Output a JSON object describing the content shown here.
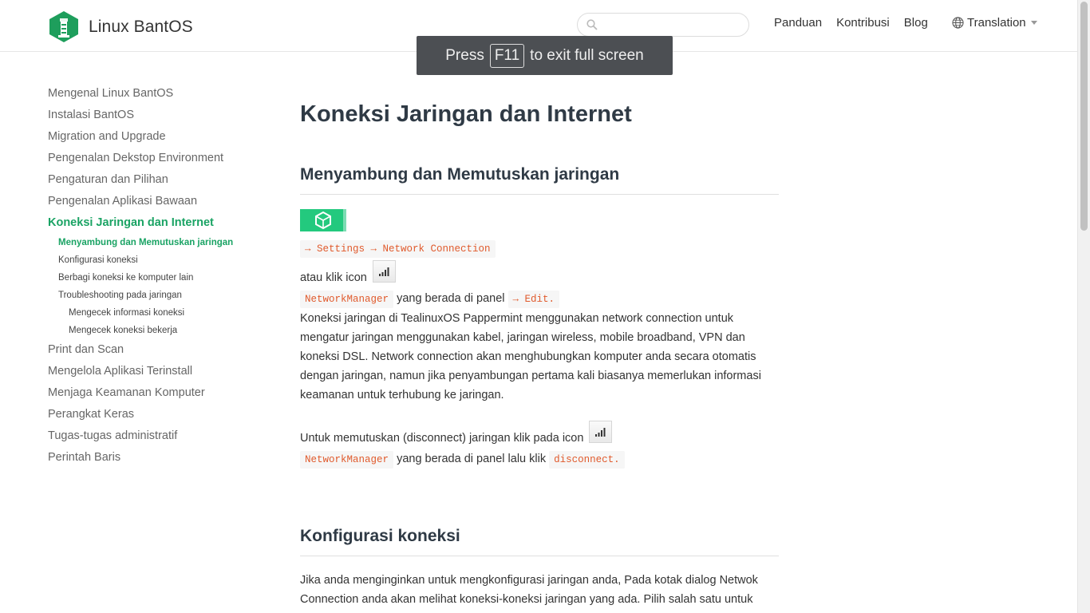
{
  "header": {
    "brand": "Linux BantOS",
    "search_placeholder": "",
    "nav": [
      "Panduan",
      "Kontribusi",
      "Blog"
    ],
    "translation": "Translation"
  },
  "fullscreen_toast": {
    "prefix": "Press",
    "key": "F11",
    "suffix": "to exit full screen"
  },
  "sidebar": {
    "items": [
      "Mengenal Linux BantOS",
      "Instalasi BantOS",
      "Migration and Upgrade",
      "Pengenalan Dekstop Environment",
      "Pengaturan dan Pilihan",
      "Pengenalan Aplikasi Bawaan",
      "Koneksi Jaringan dan Internet"
    ],
    "subitems": [
      "Menyambung dan Memutuskan jaringan",
      "Konfigurasi koneksi",
      "Berbagi koneksi ke komputer lain",
      "Troubleshooting pada jaringan"
    ],
    "subsubitems": [
      "Mengecek informasi koneksi",
      "Mengecek koneksi bekerja"
    ],
    "items_after": [
      "Print dan Scan",
      "Mengelola Aplikasi Terinstall",
      "Menjaga Keamanan Komputer",
      "Perangkat Keras",
      "Tugas-tugas administratif",
      "Perintah Baris"
    ]
  },
  "content": {
    "title": "Koneksi Jaringan dan Internet",
    "section1": {
      "heading": "Menyambung dan Memutuskan jaringan",
      "settings_path": "→ Settings → Network Connection",
      "click_icon_text": "atau klik icon",
      "network_manager": "NetworkManager",
      "panel_text": "yang berada di panel",
      "edit": "→ Edit.",
      "paragraph": "Koneksi jaringan di TealinuxOS Pappermint menggunakan network connection untuk mengatur jaringan menggunakan kabel, jaringan wireless, mobile broadband, VPN dan koneksi DSL. Network connection akan menghubungkan komputer anda secara otomatis dengan jaringan, namun jika penyambungan pertama kali biasanya memerlukan informasi keamanan untuk terhubung ke jaringan.",
      "disconnect_text": "Untuk memutuskan (disconnect) jaringan klik pada icon",
      "panel_then": "yang berada di panel lalu klik",
      "disconnect": "disconnect."
    },
    "section2": {
      "heading": "Konfigurasi koneksi",
      "paragraph": "Jika anda menginginkan untuk mengkonfigurasi jaringan anda, Pada kotak dialog Netwok Connection anda akan melihat koneksi-koneksi jaringan yang ada. Pilih salah satu untuk"
    }
  },
  "colors": {
    "accent": "#1aa364",
    "banner": "#23c97e",
    "code": "#e05a2c"
  }
}
